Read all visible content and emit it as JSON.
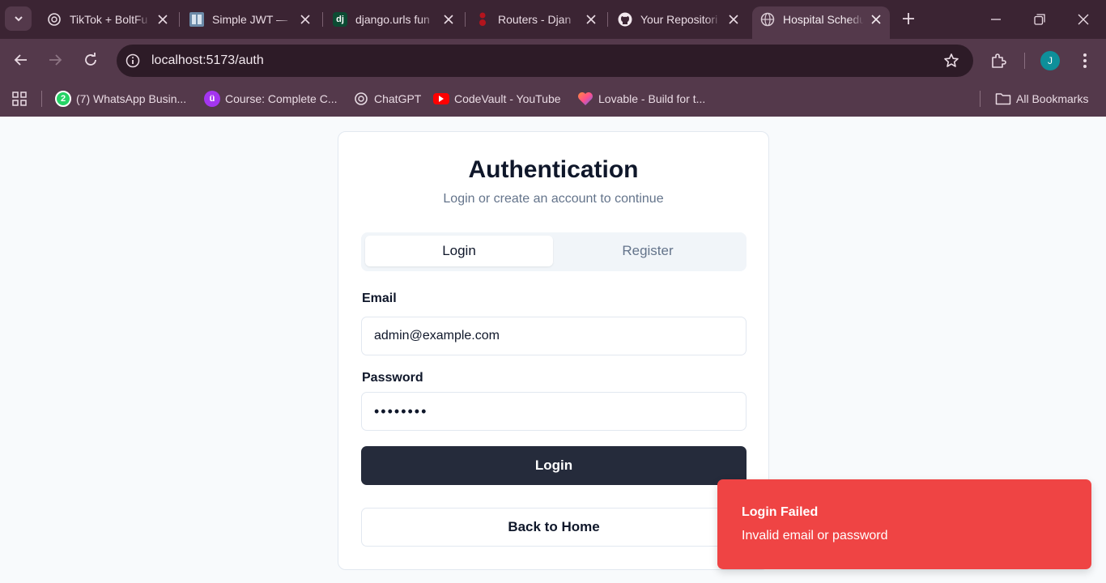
{
  "browser": {
    "tabs": [
      {
        "title": "TikTok + BoltFu",
        "icon": "openai-icon"
      },
      {
        "title": "Simple JWT —",
        "icon": "docs-icon"
      },
      {
        "title": "django.urls fun",
        "icon": "django-icon",
        "favicon_text": "dj"
      },
      {
        "title": "Routers - Djan",
        "icon": "drf-icon"
      },
      {
        "title": "Your Repositori",
        "icon": "github-icon"
      },
      {
        "title": "Hospital Schedu",
        "icon": "globe-icon",
        "active": true
      }
    ],
    "address": "localhost:5173/auth",
    "profile_initial": "J",
    "bookmarks": [
      {
        "label": "(7) WhatsApp Busin...",
        "icon": "whatsapp-icon",
        "badge": "2"
      },
      {
        "label": "Course: Complete C...",
        "icon": "udemy-icon",
        "badge": "ü"
      },
      {
        "label": "ChatGPT",
        "icon": "openai-icon"
      },
      {
        "label": "CodeVault - YouTube",
        "icon": "youtube-icon"
      },
      {
        "label": "Lovable - Build for t...",
        "icon": "lovable-icon"
      }
    ],
    "all_bookmarks": "All Bookmarks"
  },
  "auth": {
    "title": "Authentication",
    "subtitle": "Login or create an account to continue",
    "tab_login": "Login",
    "tab_register": "Register",
    "email_label": "Email",
    "email_value": "admin@example.com",
    "password_label": "Password",
    "password_value": "••••••••",
    "submit": "Login",
    "back": "Back to Home"
  },
  "toast": {
    "title": "Login Failed",
    "message": "Invalid email or password"
  },
  "colors": {
    "chrome_dark": "#3b2433",
    "chrome": "#54394b",
    "primary_button": "#252b3b",
    "toast_error": "#ef4444"
  }
}
